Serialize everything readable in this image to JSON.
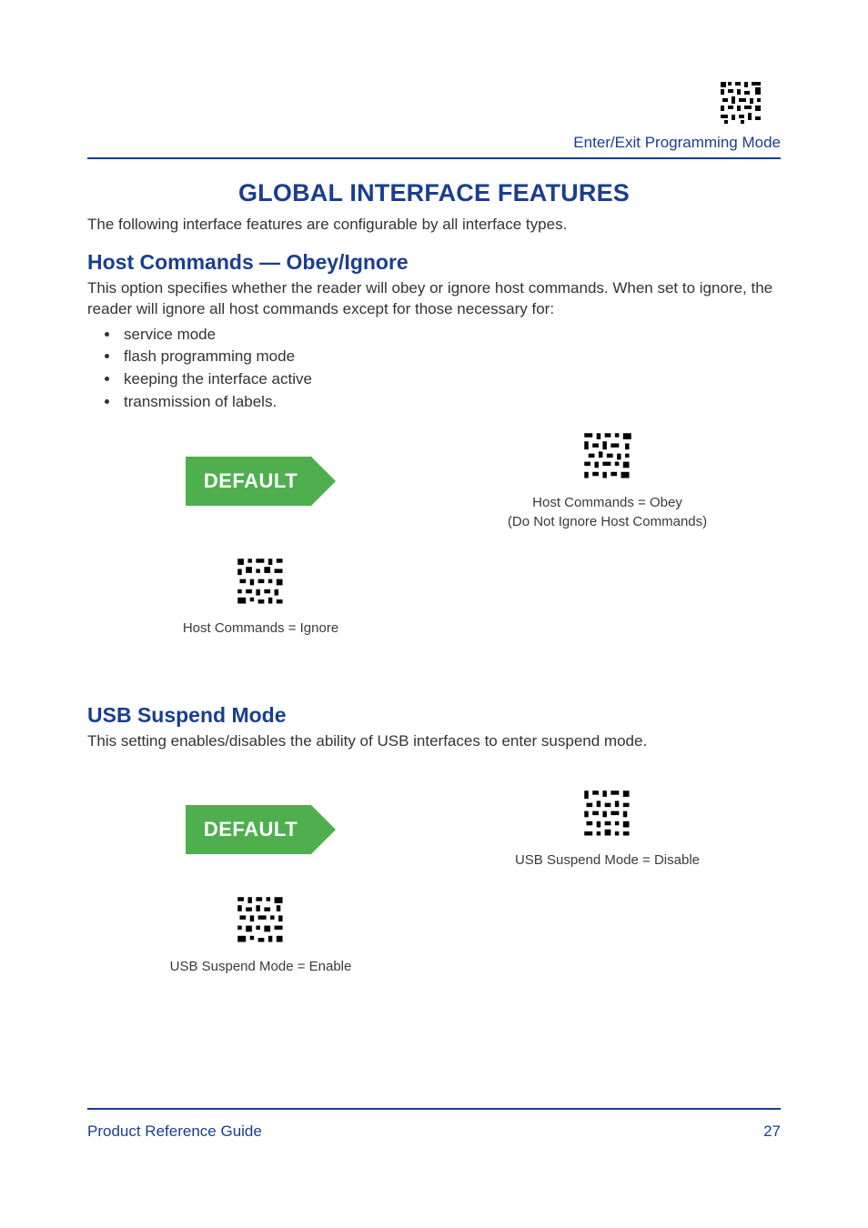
{
  "header": {
    "mode_label": "Enter/Exit Programming Mode"
  },
  "title": "GLOBAL INTERFACE FEATURES",
  "intro": "The following interface features are configurable by all interface types.",
  "section1": {
    "heading": "Host Commands — Obey/Ignore",
    "desc": "This option specifies whether the reader will obey or ignore host commands. When set to ignore, the reader will ignore all host commands except for those necessary for:",
    "bullets": [
      "service mode",
      "flash programming mode",
      "keeping the interface active",
      "transmission of labels."
    ],
    "default_label": "DEFAULT",
    "opt_obey_line1": "Host Commands = Obey",
    "opt_obey_line2": "(Do Not Ignore Host Commands)",
    "opt_ignore": "Host Commands = Ignore"
  },
  "section2": {
    "heading": "USB Suspend Mode",
    "desc": "This setting enables/disables the ability of USB interfaces to enter suspend mode.",
    "default_label": "DEFAULT",
    "opt_disable": "USB Suspend Mode = Disable",
    "opt_enable": "USB Suspend Mode = Enable"
  },
  "footer": {
    "left": "Product Reference Guide",
    "right": "27"
  }
}
